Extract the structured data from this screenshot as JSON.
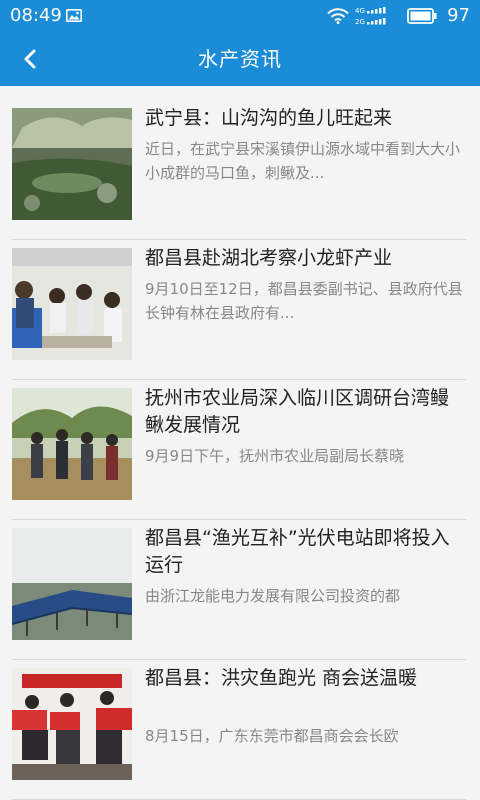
{
  "status_bar": {
    "time": "08:49",
    "network_label_top": "4G",
    "network_label_bottom": "2G",
    "battery_percent": "97",
    "icons": [
      "gallery-icon",
      "wifi-icon",
      "signal-icon",
      "battery-icon"
    ]
  },
  "header": {
    "title": "水产资讯",
    "back_icon": "chevron-left-icon",
    "color": "#1a8cd8"
  },
  "news": [
    {
      "title": "武宁县：山沟沟的鱼儿旺起来",
      "summary": "近日，在武宁县宋溪镇伊山源水域中看到大大小小成群的马口鱼，刺鳅及..."
    },
    {
      "title": "都昌县赴湖北考察小龙虾产业",
      "summary": "9月10日至12日，都昌县委副书记、县政府代县长钟有林在县政府有..."
    },
    {
      "title": "抚州市农业局深入临川区调研台湾鳗鳅发展情况",
      "summary": "9月9日下午，抚州市农业局副局长蔡晓"
    },
    {
      "title": "都昌县“渔光互补”光伏电站即将投入运行",
      "summary": "由浙江龙能电力发展有限公司投资的都"
    },
    {
      "title": "都昌县：洪灾鱼跑光 商会送温暖",
      "summary": "8月15日，广东东莞市都昌商会会长欧"
    }
  ]
}
